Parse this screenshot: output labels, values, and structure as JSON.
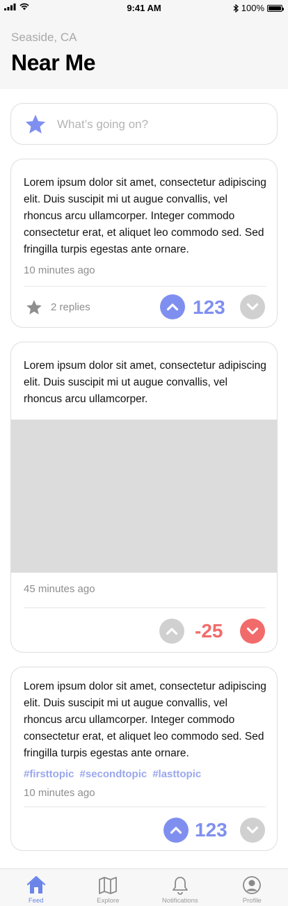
{
  "status_bar": {
    "time": "9:41 AM",
    "battery": "100%"
  },
  "header": {
    "location": "Seaside, CA",
    "title": "Near Me"
  },
  "compose": {
    "placeholder": "What’s going on?"
  },
  "posts": [
    {
      "text": "Lorem ipsum dolor sit amet, consectetur adipiscing elit. Duis suscipit mi ut augue convallis, vel rhoncus arcu ullamcorper. Integer commodo consectetur erat, et aliquet leo commodo sed. Sed fringilla turpis egestas ante ornare.",
      "timestamp": "10 minutes ago",
      "replies": "2 replies",
      "votes": "123",
      "vote_state": "up"
    },
    {
      "text": "Lorem ipsum dolor sit amet, consectetur adipiscing elit. Duis suscipit mi ut augue convallis, vel rhoncus arcu ullamcorper.",
      "timestamp": "45 minutes ago",
      "votes": "-25",
      "vote_state": "down"
    },
    {
      "text": "Lorem ipsum dolor sit amet, consectetur adipiscing elit. Duis suscipit mi ut augue convallis, vel rhoncus arcu ullamcorper. Integer commodo consectetur erat, et aliquet leo commodo sed. Sed fringilla turpis egestas ante ornare.",
      "tags": [
        "#firsttopic",
        "#secondtopic",
        "#lasttopic"
      ],
      "timestamp": "10 minutes ago",
      "votes": "123",
      "vote_state": "up"
    }
  ],
  "tab_bar": {
    "tabs": [
      {
        "label": "Feed",
        "icon": "home-icon",
        "active": true
      },
      {
        "label": "Explore",
        "icon": "map-icon",
        "active": false
      },
      {
        "label": "Notifications",
        "icon": "bell-icon",
        "active": false
      },
      {
        "label": "Profile",
        "icon": "profile-icon",
        "active": false
      }
    ]
  },
  "colors": {
    "accent": "#7f8ff0",
    "downvote": "#f26b6b",
    "inactive": "#d0d0d0",
    "tag": "#9aa7ee"
  }
}
